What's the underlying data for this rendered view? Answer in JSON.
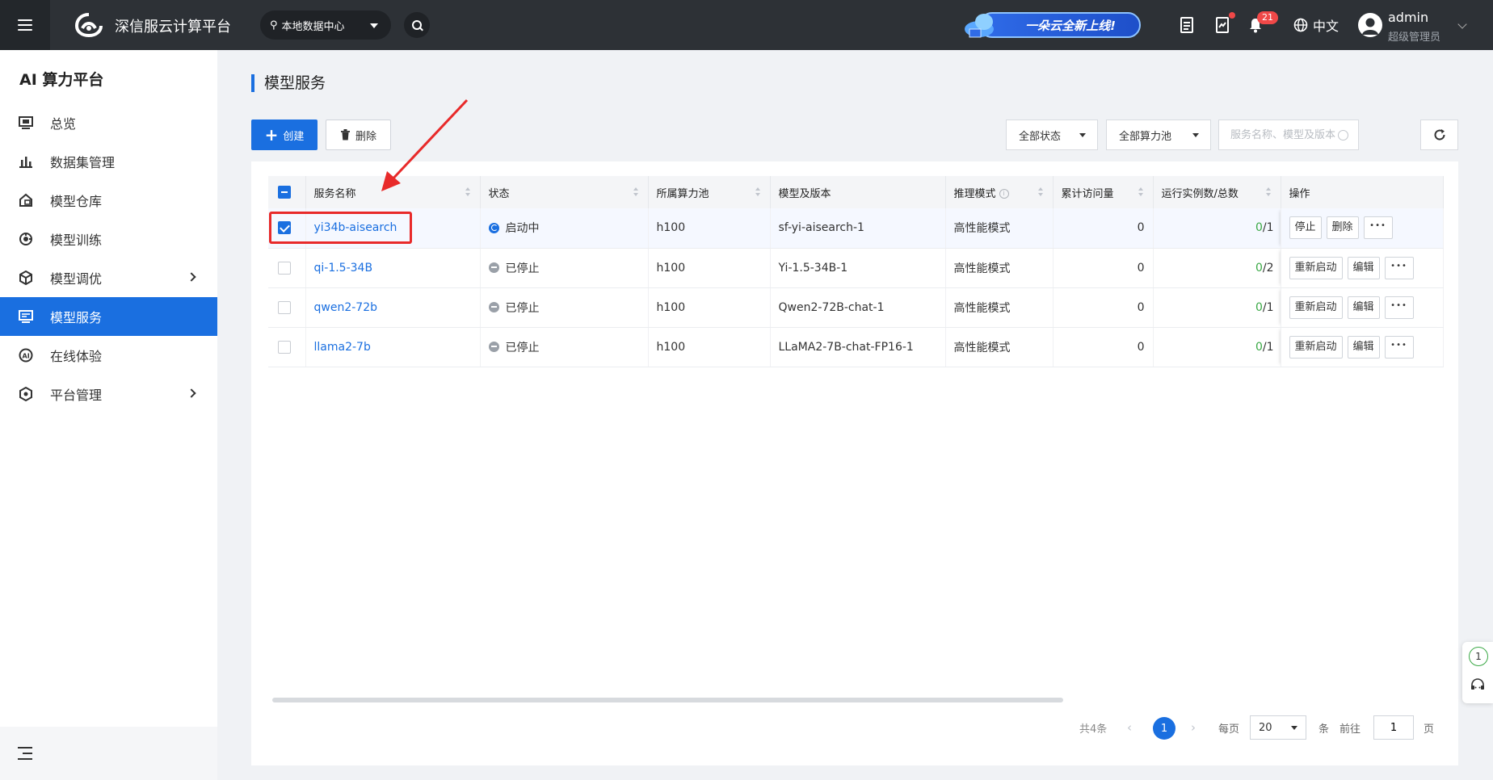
{
  "topbar": {
    "brand": "深信服云计算平台",
    "datacenter": "本地数据中心",
    "promo": "一朵云全新上线!",
    "notifications_count": "21",
    "language": "中文",
    "user_name": "admin",
    "user_role": "超级管理员"
  },
  "sidebar": {
    "title": "AI 算力平台",
    "items": [
      {
        "label": "总览",
        "icon": "monitor-icon"
      },
      {
        "label": "数据集管理",
        "icon": "bar-chart-icon"
      },
      {
        "label": "模型仓库",
        "icon": "home-cube-icon"
      },
      {
        "label": "模型训练",
        "icon": "training-icon"
      },
      {
        "label": "模型调优",
        "icon": "cube-icon",
        "has_children": true
      },
      {
        "label": "模型服务",
        "icon": "service-icon",
        "active": true
      },
      {
        "label": "在线体验",
        "icon": "ai-icon"
      },
      {
        "label": "平台管理",
        "icon": "hexagon-icon",
        "has_children": true
      }
    ]
  },
  "page": {
    "title": "模型服务",
    "create_label": "创建",
    "delete_label": "删除",
    "status_filter": "全部状态",
    "pool_filter": "全部算力池",
    "search_placeholder": "服务名称、模型及版本"
  },
  "table": {
    "columns": [
      "服务名称",
      "状态",
      "所属算力池",
      "模型及版本",
      "推理模式",
      "累计访问量",
      "运行实例数/总数",
      "操作"
    ],
    "rows": [
      {
        "name": "yi34b-aisearch",
        "status": "启动中",
        "status_type": "running",
        "pool": "h100",
        "model": "sf-yi-aisearch-1",
        "mode": "高性能模式",
        "visits": "0",
        "running": "0",
        "total": "/1",
        "ops": [
          "停止",
          "删除"
        ],
        "checked": true
      },
      {
        "name": "qi-1.5-34B",
        "status": "已停止",
        "status_type": "stopped",
        "pool": "h100",
        "model": "Yi-1.5-34B-1",
        "mode": "高性能模式",
        "visits": "0",
        "running": "0",
        "total": "/2",
        "ops": [
          "重新启动",
          "编辑"
        ],
        "checked": false
      },
      {
        "name": "qwen2-72b",
        "status": "已停止",
        "status_type": "stopped",
        "pool": "h100",
        "model": "Qwen2-72B-chat-1",
        "mode": "高性能模式",
        "visits": "0",
        "running": "0",
        "total": "/1",
        "ops": [
          "重新启动",
          "编辑"
        ],
        "checked": false
      },
      {
        "name": "llama2-7b",
        "status": "已停止",
        "status_type": "stopped",
        "pool": "h100",
        "model": "LLaMA2-7B-chat-FP16-1",
        "mode": "高性能模式",
        "visits": "0",
        "running": "0",
        "total": "/1",
        "ops": [
          "重新启动",
          "编辑"
        ],
        "checked": false
      }
    ]
  },
  "pagination": {
    "total": "共4条",
    "current": "1",
    "per_page_label": "每页",
    "page_size": "20",
    "unit": "条",
    "goto_label": "前往",
    "goto_value": "1",
    "page_label": "页"
  },
  "float_tools": {
    "counter": "1"
  },
  "colors": {
    "primary": "#1a6fe0",
    "topbar": "#2d3136",
    "annotation": "#e82a2a",
    "running_count": "#3aa845"
  }
}
